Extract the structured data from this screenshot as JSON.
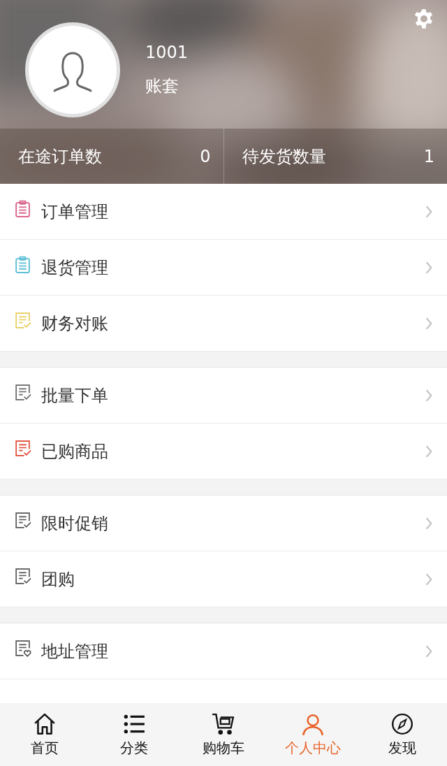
{
  "profile": {
    "account_id": "1001",
    "account_set": "账套"
  },
  "stats": [
    {
      "label": "在途订单数",
      "value": "0"
    },
    {
      "label": "待发货数量",
      "value": "1"
    }
  ],
  "menu_groups": [
    {
      "items": [
        {
          "label": "订单管理",
          "kind": "clipboard",
          "color": "#d9648c"
        },
        {
          "label": "退货管理",
          "kind": "clipboard",
          "color": "#5cbfd6"
        },
        {
          "label": "财务对账",
          "kind": "checklist",
          "color": "#e8cc5a"
        }
      ]
    },
    {
      "items": [
        {
          "label": "批量下单",
          "kind": "checklist",
          "color": "#666666"
        },
        {
          "label": "已购商品",
          "kind": "checklist",
          "color": "#e0442e"
        }
      ]
    },
    {
      "items": [
        {
          "label": "限时促销",
          "kind": "checklist",
          "color": "#555555"
        },
        {
          "label": "团购",
          "kind": "checklist",
          "color": "#555555"
        }
      ]
    },
    {
      "items": [
        {
          "label": "地址管理",
          "kind": "heart",
          "color": "#555555"
        }
      ]
    }
  ],
  "tab_bar": [
    {
      "label": "首页",
      "selected": false
    },
    {
      "label": "分类",
      "selected": false
    },
    {
      "label": "购物车",
      "selected": false
    },
    {
      "label": "个人中心",
      "selected": true
    },
    {
      "label": "发现",
      "selected": false
    }
  ]
}
